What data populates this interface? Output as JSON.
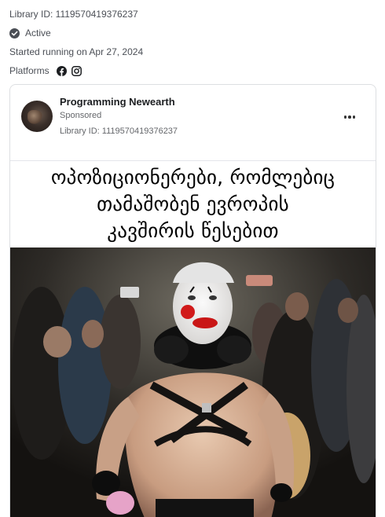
{
  "header": {
    "library_id": "Library ID: 1119570419376237",
    "status": "Active",
    "started": "Started running on Apr 27, 2024",
    "platforms_label": "Platforms"
  },
  "icons": {
    "status": "check-circle-icon",
    "platforms": [
      "facebook-icon",
      "instagram-icon"
    ]
  },
  "ad": {
    "advertiser": "Programming Newearth",
    "sponsored": "Sponsored",
    "library_id": "Library ID: 1119570419376237",
    "caption_lines": [
      "ოპოზიციონერები, რომლებიც",
      "თამაშობენ ევროპის",
      "კავშირის წესებით"
    ]
  }
}
